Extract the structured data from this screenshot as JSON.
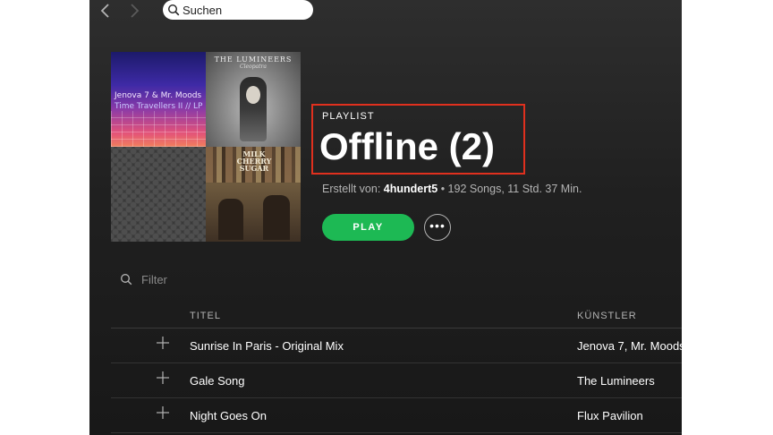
{
  "search": {
    "placeholder": "Suchen"
  },
  "playlist": {
    "type_label": "PLAYLIST",
    "title": "Offline (2)",
    "created_by_label": "Erstellt von:",
    "owner": "4hundert5",
    "stats": " • 192 Songs, 11 Std. 37 Min.",
    "play_label": "PLAY",
    "more_label": "•••"
  },
  "cover": {
    "tile1_line1": "Jenova 7 & Mr. Moods",
    "tile1_line2": "Time Travellers II // LP",
    "tile2_line1": "THE LUMINEERS",
    "tile2_line2": "Cleopatra",
    "tile4_text": "MILK CHERRY SUGAR"
  },
  "filter": {
    "placeholder": "Filter"
  },
  "columns": {
    "title": "TITEL",
    "artist": "KÜNSTLER"
  },
  "tracks": [
    {
      "title": "Sunrise In Paris - Original Mix",
      "artist": "Jenova 7, Mr. Moods"
    },
    {
      "title": "Gale Song",
      "artist": "The Lumineers"
    },
    {
      "title": "Night Goes On",
      "artist": "Flux Pavilion"
    }
  ],
  "colors": {
    "accent": "#1db954",
    "highlight": "#e0301e",
    "background": "#181818"
  }
}
